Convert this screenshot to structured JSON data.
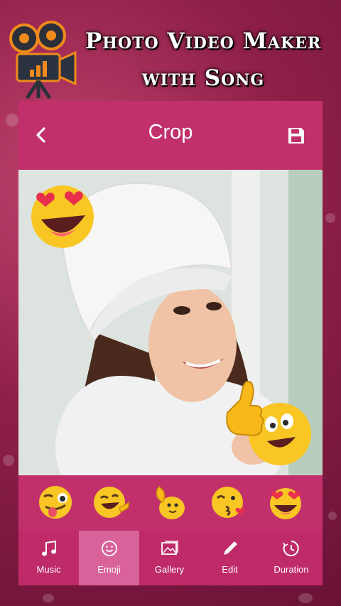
{
  "banner": {
    "title_line1": "Photo Video Maker",
    "title_line2": "with Song",
    "logo_icon": "movie-camera-icon"
  },
  "appbar": {
    "title": "Crop",
    "back_icon": "chevron-left-icon",
    "save_icon": "floppy-disk-icon"
  },
  "photo": {
    "description_icon": "woman-photo",
    "stickers": [
      "heart-eyes-emoji",
      "thumbs-up-emoji"
    ]
  },
  "emoji_tray": {
    "items": [
      "winking-tongue-emoji",
      "laughing-pointing-emoji",
      "waving-hand-emoji",
      "kissing-heart-emoji",
      "heart-eyes-emoji"
    ]
  },
  "nav": {
    "items": [
      {
        "label": "Music",
        "icon": "music-note-icon"
      },
      {
        "label": "Emoji",
        "icon": "smiley-icon"
      },
      {
        "label": "Gallery",
        "icon": "image-icon"
      },
      {
        "label": "Edit",
        "icon": "pencil-icon"
      },
      {
        "label": "Duration",
        "icon": "timer-icon"
      }
    ],
    "active_index": 1
  },
  "colors": {
    "accent": "#c2306c",
    "nav_active": "#d9629a"
  }
}
